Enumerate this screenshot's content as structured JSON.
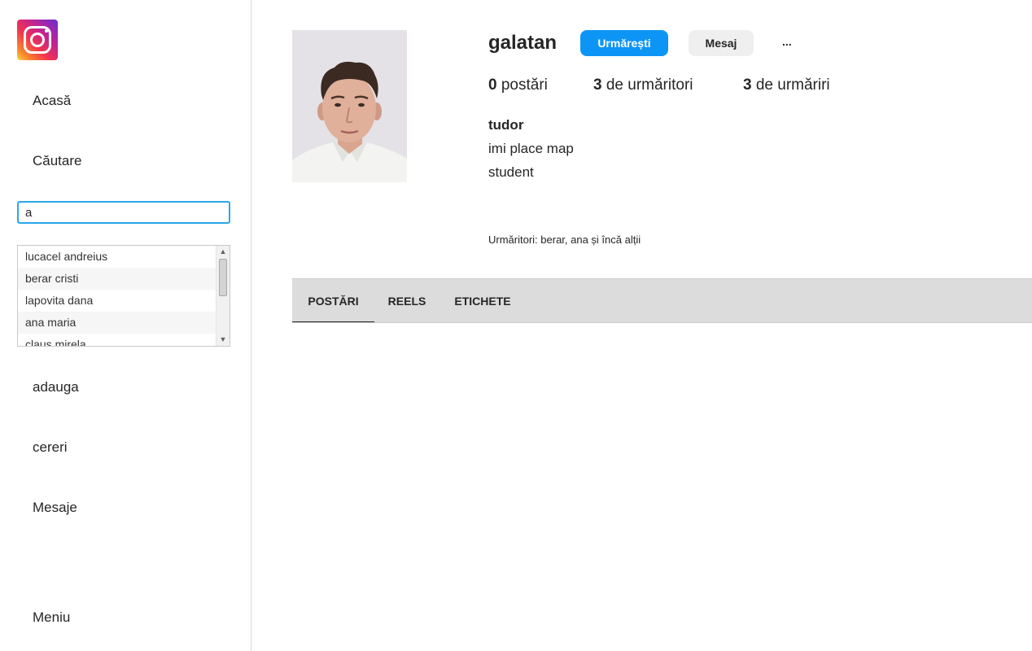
{
  "sidebar": {
    "logo_icon": "instagram-icon",
    "nav": {
      "home": "Acasă",
      "search": "Căutare",
      "add": "adauga",
      "requests": "cereri",
      "messages": "Mesaje",
      "menu": "Meniu"
    },
    "search": {
      "value": "a",
      "results": [
        "lucacel andreius",
        "berar cristi",
        "lapovita dana",
        "ana maria",
        "claus mirela"
      ]
    }
  },
  "profile": {
    "username": "galatan",
    "follow_label": "Urmărești",
    "message_label": "Mesaj",
    "more_label": "...",
    "stats": {
      "posts_count": "0",
      "posts_label": "postări",
      "followers_count": "3",
      "followers_label": "de urmăritori",
      "following_count": "3",
      "following_label": "de urmăriri"
    },
    "full_name": "tudor",
    "bio_lines": [
      "imi place map",
      "student"
    ],
    "followed_by": "Urmăritori: berar, ana și încă alții"
  },
  "tabs": [
    "POSTĂRI",
    "REELS",
    "ETICHETE"
  ],
  "colors": {
    "accent": "#0d95f6",
    "search_focus": "#2aa7e8",
    "tabs_bg": "#dcdcdc"
  }
}
